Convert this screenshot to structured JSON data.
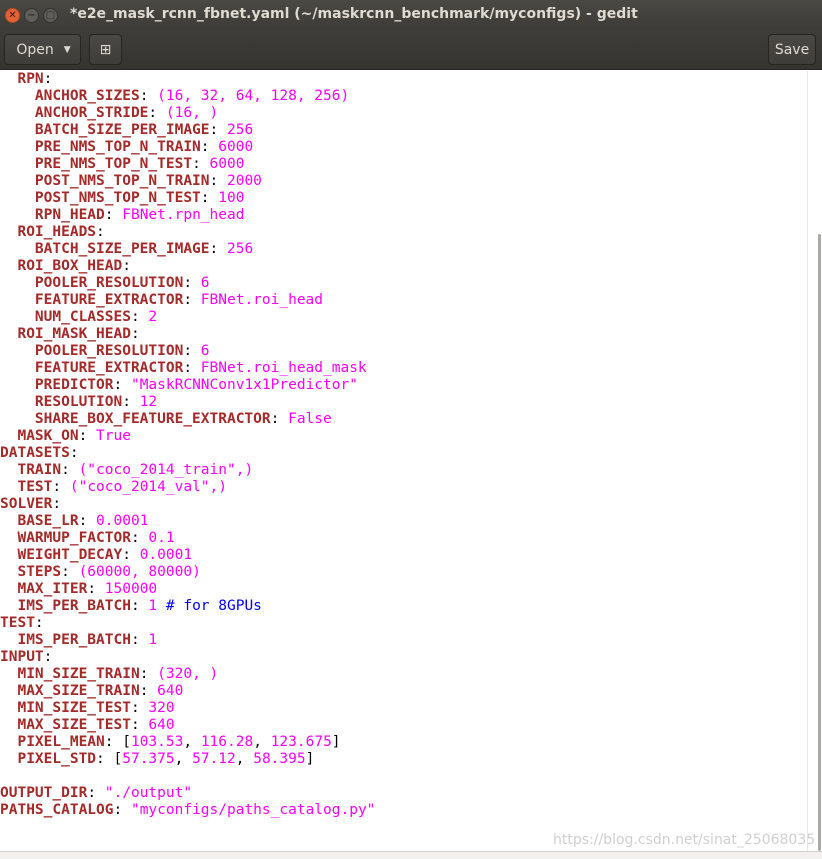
{
  "window": {
    "title": "*e2e_mask_rcnn_fbnet.yaml (~/maskrcnn_benchmark/myconfigs) - gedit",
    "close_glyph": "✕",
    "minimize_glyph": "−",
    "maximize_glyph": "□"
  },
  "toolbar": {
    "open_label": "Open",
    "open_caret": "▼",
    "new_tab_glyph": "⊞",
    "save_label": "Save"
  },
  "colors": {
    "key": "#a52a2a",
    "value": "#ff00ff",
    "comment": "#0000ff",
    "punct": "#000000"
  },
  "editor": {
    "lines": [
      [
        {
          "t": "k",
          "s": "  RPN"
        },
        {
          "t": "p",
          "s": ":"
        }
      ],
      [
        {
          "t": "k",
          "s": "    ANCHOR_SIZES"
        },
        {
          "t": "p",
          "s": ": "
        },
        {
          "t": "v",
          "s": "(16, 32, 64, 128, 256)"
        }
      ],
      [
        {
          "t": "k",
          "s": "    ANCHOR_STRIDE"
        },
        {
          "t": "p",
          "s": ": "
        },
        {
          "t": "v",
          "s": "(16, )"
        }
      ],
      [
        {
          "t": "k",
          "s": "    BATCH_SIZE_PER_IMAGE"
        },
        {
          "t": "p",
          "s": ": "
        },
        {
          "t": "v",
          "s": "256"
        }
      ],
      [
        {
          "t": "k",
          "s": "    PRE_NMS_TOP_N_TRAIN"
        },
        {
          "t": "p",
          "s": ": "
        },
        {
          "t": "v",
          "s": "6000"
        }
      ],
      [
        {
          "t": "k",
          "s": "    PRE_NMS_TOP_N_TEST"
        },
        {
          "t": "p",
          "s": ": "
        },
        {
          "t": "v",
          "s": "6000"
        }
      ],
      [
        {
          "t": "k",
          "s": "    POST_NMS_TOP_N_TRAIN"
        },
        {
          "t": "p",
          "s": ": "
        },
        {
          "t": "v",
          "s": "2000"
        }
      ],
      [
        {
          "t": "k",
          "s": "    POST_NMS_TOP_N_TEST"
        },
        {
          "t": "p",
          "s": ": "
        },
        {
          "t": "v",
          "s": "100"
        }
      ],
      [
        {
          "t": "k",
          "s": "    RPN_HEAD"
        },
        {
          "t": "p",
          "s": ": "
        },
        {
          "t": "v",
          "s": "FBNet.rpn_head"
        }
      ],
      [
        {
          "t": "k",
          "s": "  ROI_HEADS"
        },
        {
          "t": "p",
          "s": ":"
        }
      ],
      [
        {
          "t": "k",
          "s": "    BATCH_SIZE_PER_IMAGE"
        },
        {
          "t": "p",
          "s": ": "
        },
        {
          "t": "v",
          "s": "256"
        }
      ],
      [
        {
          "t": "k",
          "s": "  ROI_BOX_HEAD"
        },
        {
          "t": "p",
          "s": ":"
        }
      ],
      [
        {
          "t": "k",
          "s": "    POOLER_RESOLUTION"
        },
        {
          "t": "p",
          "s": ": "
        },
        {
          "t": "v",
          "s": "6"
        }
      ],
      [
        {
          "t": "k",
          "s": "    FEATURE_EXTRACTOR"
        },
        {
          "t": "p",
          "s": ": "
        },
        {
          "t": "v",
          "s": "FBNet.roi_head"
        }
      ],
      [
        {
          "t": "k",
          "s": "    NUM_CLASSES"
        },
        {
          "t": "p",
          "s": ": "
        },
        {
          "t": "v",
          "s": "2"
        }
      ],
      [
        {
          "t": "k",
          "s": "  ROI_MASK_HEAD"
        },
        {
          "t": "p",
          "s": ":"
        }
      ],
      [
        {
          "t": "k",
          "s": "    POOLER_RESOLUTION"
        },
        {
          "t": "p",
          "s": ": "
        },
        {
          "t": "v",
          "s": "6"
        }
      ],
      [
        {
          "t": "k",
          "s": "    FEATURE_EXTRACTOR"
        },
        {
          "t": "p",
          "s": ": "
        },
        {
          "t": "v",
          "s": "FBNet.roi_head_mask"
        }
      ],
      [
        {
          "t": "k",
          "s": "    PREDICTOR"
        },
        {
          "t": "p",
          "s": ": "
        },
        {
          "t": "v",
          "s": "\"MaskRCNNConv1x1Predictor\""
        }
      ],
      [
        {
          "t": "k",
          "s": "    RESOLUTION"
        },
        {
          "t": "p",
          "s": ": "
        },
        {
          "t": "v",
          "s": "12"
        }
      ],
      [
        {
          "t": "k",
          "s": "    SHARE_BOX_FEATURE_EXTRACTOR"
        },
        {
          "t": "p",
          "s": ": "
        },
        {
          "t": "v",
          "s": "False"
        }
      ],
      [
        {
          "t": "k",
          "s": "  MASK_ON"
        },
        {
          "t": "p",
          "s": ": "
        },
        {
          "t": "v",
          "s": "True"
        }
      ],
      [
        {
          "t": "k",
          "s": "DATASETS"
        },
        {
          "t": "p",
          "s": ":"
        }
      ],
      [
        {
          "t": "k",
          "s": "  TRAIN"
        },
        {
          "t": "p",
          "s": ": "
        },
        {
          "t": "v",
          "s": "(\"coco_2014_train\",)"
        }
      ],
      [
        {
          "t": "k",
          "s": "  TEST"
        },
        {
          "t": "p",
          "s": ": "
        },
        {
          "t": "v",
          "s": "(\"coco_2014_val\",)"
        }
      ],
      [
        {
          "t": "k",
          "s": "SOLVER"
        },
        {
          "t": "p",
          "s": ":"
        }
      ],
      [
        {
          "t": "k",
          "s": "  BASE_LR"
        },
        {
          "t": "p",
          "s": ": "
        },
        {
          "t": "v",
          "s": "0.0001"
        }
      ],
      [
        {
          "t": "k",
          "s": "  WARMUP_FACTOR"
        },
        {
          "t": "p",
          "s": ": "
        },
        {
          "t": "v",
          "s": "0.1"
        }
      ],
      [
        {
          "t": "k",
          "s": "  WEIGHT_DECAY"
        },
        {
          "t": "p",
          "s": ": "
        },
        {
          "t": "v",
          "s": "0.0001"
        }
      ],
      [
        {
          "t": "k",
          "s": "  STEPS"
        },
        {
          "t": "p",
          "s": ": "
        },
        {
          "t": "v",
          "s": "(60000, 80000)"
        }
      ],
      [
        {
          "t": "k",
          "s": "  MAX_ITER"
        },
        {
          "t": "p",
          "s": ": "
        },
        {
          "t": "v",
          "s": "150000"
        }
      ],
      [
        {
          "t": "k",
          "s": "  IMS_PER_BATCH"
        },
        {
          "t": "p",
          "s": ": "
        },
        {
          "t": "v",
          "s": "1"
        },
        {
          "t": "c",
          "s": " # for 8GPUs"
        }
      ],
      [
        {
          "t": "k",
          "s": "TEST"
        },
        {
          "t": "p",
          "s": ":"
        }
      ],
      [
        {
          "t": "k",
          "s": "  IMS_PER_BATCH"
        },
        {
          "t": "p",
          "s": ": "
        },
        {
          "t": "v",
          "s": "1"
        }
      ],
      [
        {
          "t": "k",
          "s": "INPUT"
        },
        {
          "t": "p",
          "s": ":"
        }
      ],
      [
        {
          "t": "k",
          "s": "  MIN_SIZE_TRAIN"
        },
        {
          "t": "p",
          "s": ": "
        },
        {
          "t": "v",
          "s": "(320, )"
        }
      ],
      [
        {
          "t": "k",
          "s": "  MAX_SIZE_TRAIN"
        },
        {
          "t": "p",
          "s": ": "
        },
        {
          "t": "v",
          "s": "640"
        }
      ],
      [
        {
          "t": "k",
          "s": "  MIN_SIZE_TEST"
        },
        {
          "t": "p",
          "s": ": "
        },
        {
          "t": "v",
          "s": "320"
        }
      ],
      [
        {
          "t": "k",
          "s": "  MAX_SIZE_TEST"
        },
        {
          "t": "p",
          "s": ": "
        },
        {
          "t": "v",
          "s": "640"
        }
      ],
      [
        {
          "t": "k",
          "s": "  PIXEL_MEAN"
        },
        {
          "t": "p",
          "s": ": ["
        },
        {
          "t": "v",
          "s": "103.53"
        },
        {
          "t": "p",
          "s": ", "
        },
        {
          "t": "v",
          "s": "116.28"
        },
        {
          "t": "p",
          "s": ", "
        },
        {
          "t": "v",
          "s": "123.675"
        },
        {
          "t": "p",
          "s": "]"
        }
      ],
      [
        {
          "t": "k",
          "s": "  PIXEL_STD"
        },
        {
          "t": "p",
          "s": ": ["
        },
        {
          "t": "v",
          "s": "57.375"
        },
        {
          "t": "p",
          "s": ", "
        },
        {
          "t": "v",
          "s": "57.12"
        },
        {
          "t": "p",
          "s": ", "
        },
        {
          "t": "v",
          "s": "58.395"
        },
        {
          "t": "p",
          "s": "]"
        }
      ],
      [],
      [
        {
          "t": "k",
          "s": "OUTPUT_DIR"
        },
        {
          "t": "p",
          "s": ": "
        },
        {
          "t": "v",
          "s": "\"./output\""
        }
      ],
      [
        {
          "t": "k",
          "s": "PATHS_CATALOG"
        },
        {
          "t": "p",
          "s": ": "
        },
        {
          "t": "v",
          "s": "\"myconfigs/paths_catalog.py\""
        }
      ]
    ]
  },
  "watermark": "https://blog.csdn.net/sinat_25068035"
}
